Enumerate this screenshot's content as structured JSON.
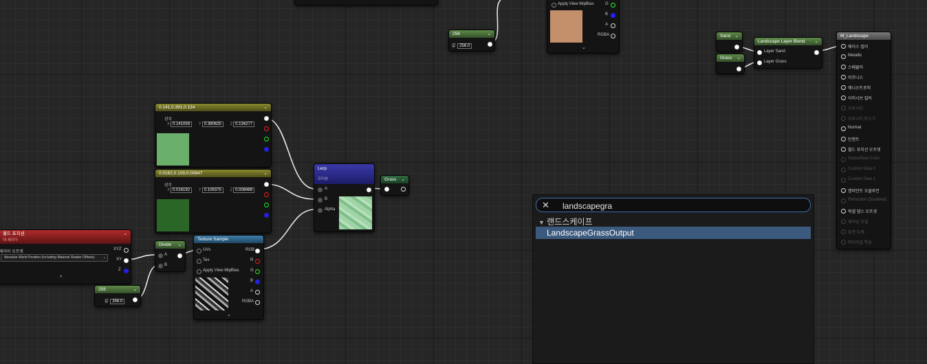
{
  "colors": {
    "lerp_header": "#2b2b96",
    "texture_header": "#2e6a8a",
    "world_pos_header": "#8e2020",
    "const_header": "#7a7a28"
  },
  "top_node": {
    "chevron": "^"
  },
  "top_const_256": {
    "title": "256",
    "label": "값",
    "value": "256.0"
  },
  "top_texture": {
    "pin_label": "Apply View MipBias",
    "outputs": [
      "G",
      "B",
      "A",
      "RGBA"
    ],
    "swatch_color": "#c4906c",
    "chevron": "⌄"
  },
  "color_node_1": {
    "title": "0.141,0.391,0.134",
    "subtitle": "상수",
    "x": "0.141059",
    "y": "0.390625",
    "z": "0.134277",
    "axes": [
      "X",
      "Y",
      "Z"
    ],
    "swatch_color": "#6aaf6a"
  },
  "color_node_2": {
    "title": "0.0162,0.109,0.00847",
    "subtitle": "상수",
    "x": "0.016192",
    "y": "0.109375",
    "z": "0.008469",
    "axes": [
      "X",
      "Y",
      "Z"
    ],
    "swatch_color": "#2a6626"
  },
  "lerp": {
    "title": "Lerp",
    "subtitle": "프리뷰",
    "pins": [
      "A",
      "B",
      "Alpha"
    ]
  },
  "grass_output": {
    "title": "Grass"
  },
  "world_pos": {
    "title": "월드 포지션",
    "subtitle": "대 세이더",
    "label": "세이아 오프셋",
    "dropdown": "Absolute World Position (Including Material Shader Offsets)",
    "outputs": [
      "XYZ",
      "XY",
      "Z"
    ],
    "chevron": "^"
  },
  "divide": {
    "title": "Divide",
    "pins": [
      "A",
      "B"
    ]
  },
  "const_256": {
    "title": "256",
    "label": "값",
    "value": "256.0"
  },
  "texture_sample": {
    "title": "Texture Sample",
    "inputs": [
      "UVs",
      "Tex",
      "Apply View MipBias"
    ],
    "outputs": [
      "RGB",
      "R",
      "G",
      "B",
      "A",
      "RGBA"
    ],
    "chevron": "⌄"
  },
  "sand_node": {
    "title": "Sand"
  },
  "grass_node": {
    "title": "Grass"
  },
  "layer_blend": {
    "title": "Landscape Layer Blend",
    "pins": [
      "Layer Sand",
      "Layer Grass"
    ]
  },
  "material": {
    "title": "M_Landscape",
    "pins": [
      {
        "label": "베이스 컬러",
        "enabled": true
      },
      {
        "label": "Metallic",
        "enabled": true
      },
      {
        "label": "스페큘러",
        "enabled": true
      },
      {
        "label": "러프니스",
        "enabled": true
      },
      {
        "label": "애니소트로피",
        "enabled": true
      },
      {
        "label": "이미시브 컬러",
        "enabled": true
      },
      {
        "label": "오파시티",
        "enabled": false
      },
      {
        "label": "오파시티 마스크",
        "enabled": false
      },
      {
        "label": "Normal",
        "enabled": true
      },
      {
        "label": "탄젠트",
        "enabled": true
      },
      {
        "label": "월드 포지션 오프셋",
        "enabled": true
      },
      {
        "label": "Subsurface Color",
        "enabled": false
      },
      {
        "label": "Custom Data 0",
        "enabled": false
      },
      {
        "label": "Custom Data 1",
        "enabled": false
      },
      {
        "label": "앰비언트 오클루전",
        "enabled": true
      },
      {
        "label": "Refraction (Disabled)",
        "enabled": false
      },
      {
        "label": "픽셀 뎁스 오프셋",
        "enabled": true
      },
      {
        "label": "셰이딩 모델",
        "enabled": false
      },
      {
        "label": "표면 두께",
        "enabled": false
      },
      {
        "label": "머티리얼 특성",
        "enabled": false
      }
    ]
  },
  "search": {
    "query": "landscapegra",
    "category": "랜드스케이프",
    "result": "LandscapeGrassOutput",
    "close_icon": "close-icon",
    "category_icon": "triangle-down-icon"
  }
}
